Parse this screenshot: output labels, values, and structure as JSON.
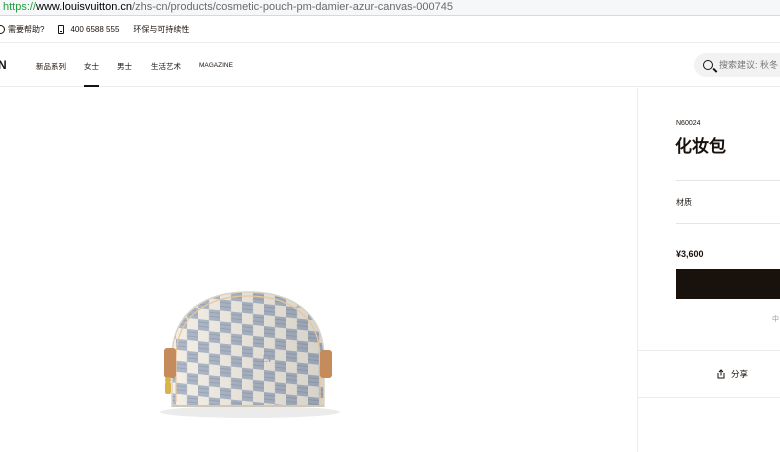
{
  "browser": {
    "url_scheme": "https://",
    "url_host": "www.louisvuitton.cn",
    "url_path": "/zhs-cn/products/cosmetic-pouch-pm-damier-azur-canvas-000745"
  },
  "utility_bar": {
    "help": "需要帮助?",
    "phone": "400 6588 555",
    "sustainability": "环保与可持续性"
  },
  "header": {
    "logo_fragment": "N",
    "nav": [
      "新品系列",
      "女士",
      "男士",
      "生活艺术",
      "MAGAZINE"
    ],
    "search_placeholder": "搜索建议: 秋冬"
  },
  "product": {
    "sku": "N60024",
    "name": "化妆包",
    "material_label": "材质",
    "price": "¥3,600",
    "partial_note": "中",
    "share_label": "分享"
  },
  "icons": {
    "help": "help-circle-icon",
    "phone": "phone-icon",
    "search": "search-icon",
    "share": "share-icon"
  },
  "colors": {
    "brand_dark": "#19110b",
    "canvas_light": "#f3efe6",
    "canvas_blue": "#aeb8c8",
    "trim": "#c68b5a"
  }
}
